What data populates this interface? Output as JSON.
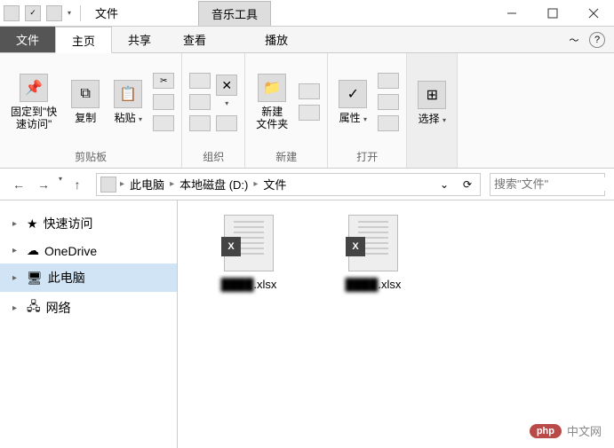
{
  "title": "文件",
  "tool_tab": "音乐工具",
  "tabs": {
    "file": "文件",
    "home": "主页",
    "share": "共享",
    "view": "查看",
    "play": "播放"
  },
  "ribbon": {
    "pin": "固定到\"快\n速访问\"",
    "copy": "复制",
    "paste": "粘贴",
    "clipboard": "剪贴板",
    "delete_x": "✕",
    "organize": "组织",
    "newfolder": "新建\n文件夹",
    "new": "新建",
    "properties": "属性",
    "open": "打开",
    "select": "选择"
  },
  "breadcrumb": {
    "pc": "此电脑",
    "drive": "本地磁盘 (D:)",
    "folder": "文件"
  },
  "search": {
    "placeholder": "搜索\"文件\""
  },
  "sidebar": {
    "quick": "快速访问",
    "onedrive": "OneDrive",
    "pc": "此电脑",
    "network": "网络"
  },
  "files": [
    {
      "name_blur": "████",
      "ext": ".xlsx"
    },
    {
      "name_blur": "████",
      "ext": ".xlsx"
    }
  ],
  "watermark": {
    "badge": "php",
    "text": "中文网"
  }
}
